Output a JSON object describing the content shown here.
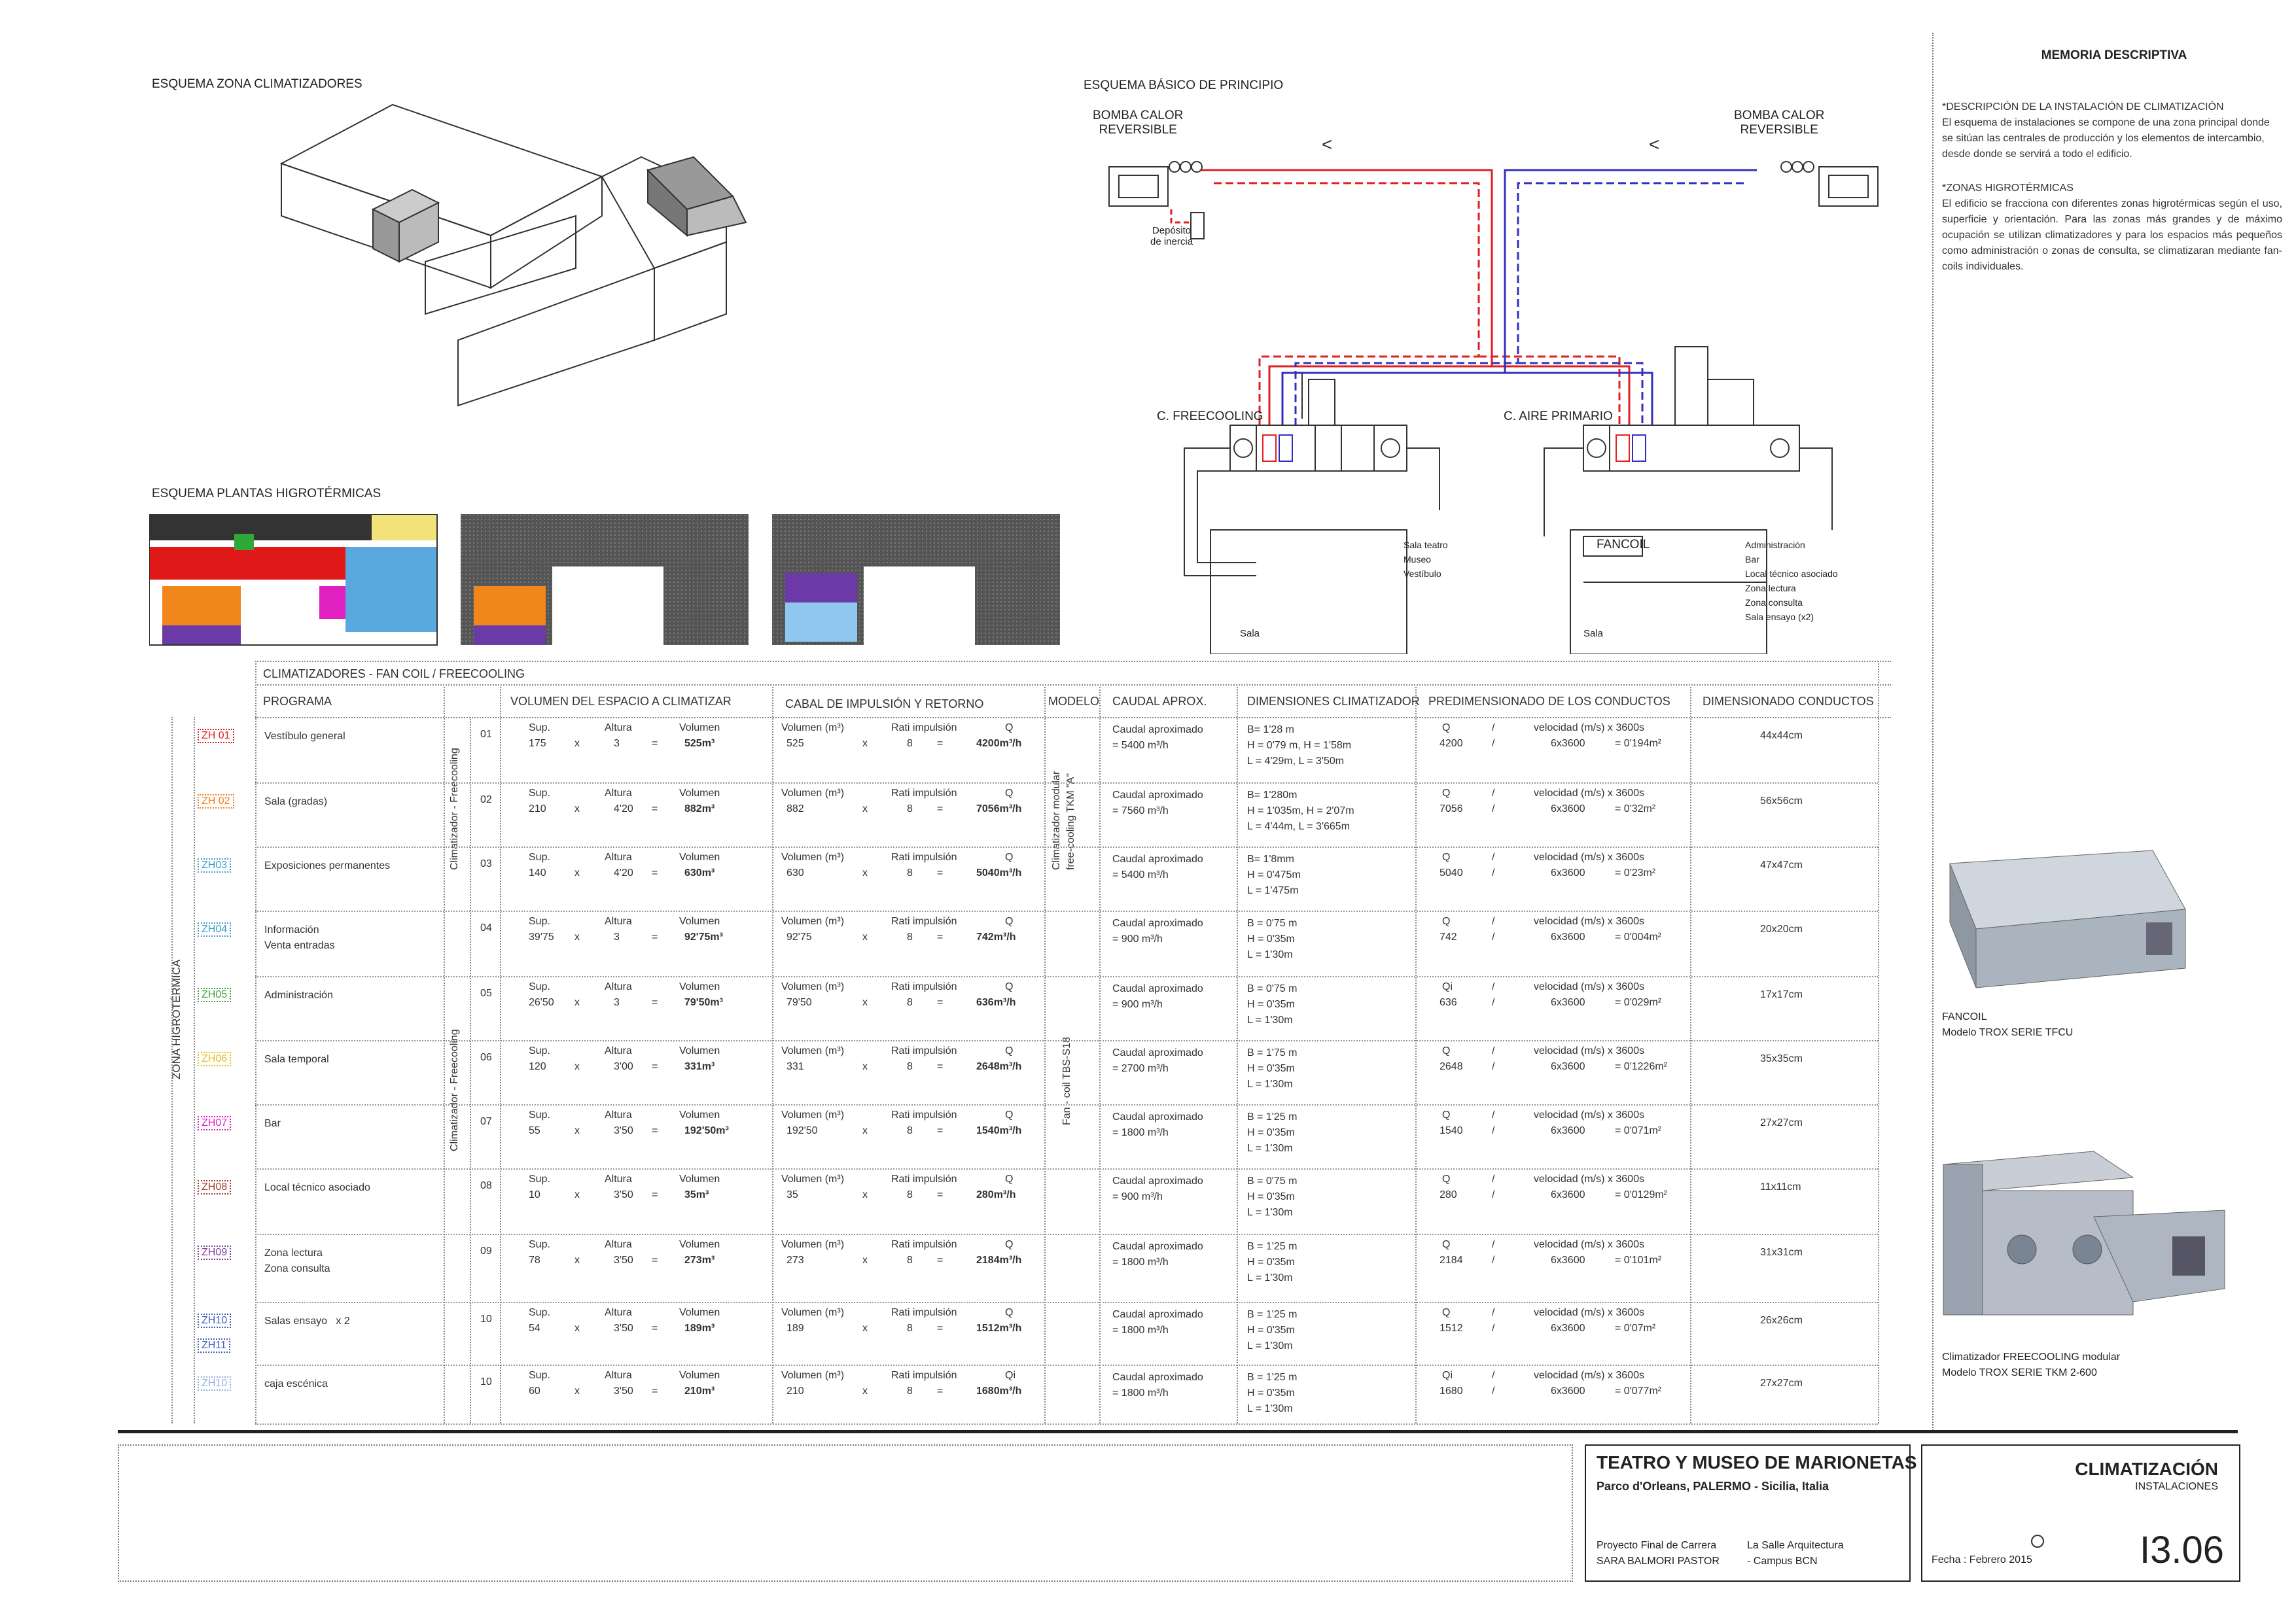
{
  "labels": {
    "esq_zona": "ESQUEMA ZONA CLIMATIZADORES",
    "esq_basico": "ESQUEMA BÁSICO DE PRINCIPIO",
    "esq_plantas": "ESQUEMA PLANTAS HIGROTÉRMICAS",
    "bomba1": "BOMBA CALOR\nREVERSIBLE",
    "bomba2": "BOMBA CALOR\nREVERSIBLE",
    "deposito": "Depósito\nde inercia",
    "freecooling": "C. FREECOOLING",
    "aire_primario": "C. AIRE PRIMARIO",
    "fancoil": "FANCOIL",
    "sala1": "Sala",
    "sala2": "Sala",
    "sala_teatro": "Sala teatro\nMuseo\nVestíbulo",
    "admin_list": "Administración\nBar\nLocal técnico asociado\nZona lectura\nZona consulta\nSala ensayo (x2)"
  },
  "memoria": {
    "title": "MEMORIA DESCRIPTIVA",
    "h1": "*DESCRIPCIÓN DE LA INSTALACIÓN DE CLIMATIZACIÓN",
    "p1": "El esquema de instalaciones se compone de una zona principal donde se sitúan las centrales de producción y los elementos de intercambio, desde donde se servirá a todo el edificio.",
    "h2": "*ZONAS HIGROTÉRMICAS",
    "p2": "El edificio se fracciona con diferentes zonas higrotérmicas según el uso, superficie y orientación. Para las zonas más grandes y de máximo ocupación se utilizan climatizadores y para los espacios más pequeños como administración o zonas de consulta, se climatizaran mediante fan-coils individuales.",
    "fancoil_cap1": "FANCOIL",
    "fancoil_cap2": "Modelo TROX SERIE TFCU",
    "clim_cap1": "Climatizador FREECOOLING modular",
    "clim_cap2": "Modelo TROX SERIE TKM 2-600"
  },
  "table": {
    "title": "CLIMATIZADORES - FAN COIL / FREECOOLING",
    "headers": [
      "PROGRAMA",
      "VOLUMEN DEL ESPACIO A CLIMATIZAR",
      "CABAL DE IMPULSIÓN Y RETORNO",
      "MODELO",
      "CAUDAL APROX.",
      "DIMENSIONES CLIMATIZADOR",
      "PREDIMENSIONADO DE LOS CONDUCTOS",
      "DIMENSIONADO CONDUCTOS"
    ],
    "zona_label": "ZONA HIGROTÉRMICA",
    "group1": "Climatizador - Freecooling",
    "group2": "Climatizador - Freecooling",
    "model1": "Climatizador modular\nfree-cooling TKM \"A\"",
    "model2": "Fan - coil TBS-S18",
    "rows": [
      {
        "zh": "ZH 01",
        "color": "#e02020",
        "prog": "Vestíbulo general",
        "n": "01",
        "sup": "175",
        "alt": "3",
        "vol": "525m³",
        "cv": "525",
        "rat": "8",
        "q": "4200m³/h",
        "caudal": "Caudal aproximado\n= 5400 m³/h",
        "dims": "B= 1'28 m\nH = 0'79 m, H = 1'58m\nL = 4'29m, L = 3'50m",
        "qi": "4200",
        "den": "6x3600",
        "res": "= 0'194m²",
        "dim": "44x44cm"
      },
      {
        "zh": "ZH 02",
        "color": "#f08020",
        "prog": "Sala (gradas)",
        "n": "02",
        "sup": "210",
        "alt": "4'20",
        "vol": "882m³",
        "cv": "882",
        "rat": "8",
        "q": "7056m³/h",
        "caudal": "Caudal aproximado\n= 7560 m³/h",
        "dims": "B= 1'280m\nH = 1'035m, H = 2'07m\nL = 4'44m, L = 3'665m",
        "qi": "7056",
        "den": "6x3600",
        "res": "= 0'32m²",
        "dim": "56x56cm"
      },
      {
        "zh": "ZH03",
        "color": "#3aa0d0",
        "prog": "Exposiciones permanentes",
        "n": "03",
        "sup": "140",
        "alt": "4'20",
        "vol": "630m³",
        "cv": "630",
        "rat": "8",
        "q": "5040m³/h",
        "caudal": "Caudal aproximado\n= 5400 m³/h",
        "dims": "B= 1'8mm\nH = 0'475m\nL = 1'475m",
        "qi": "5040",
        "den": "6x3600",
        "res": "= 0'23m²",
        "dim": "47x47cm"
      },
      {
        "zh": "ZH04",
        "color": "#3aa0d0",
        "prog": "Información\nVenta entradas",
        "n": "04",
        "sup": "39'75",
        "alt": "3",
        "vol": "92'75m³",
        "cv": "92'75",
        "rat": "8",
        "q": "742m³/h",
        "caudal": "Caudal aproximado\n= 900 m³/h",
        "dims": "B = 0'75 m\nH = 0'35m\nL = 1'30m",
        "qi": "742",
        "den": "6x3600",
        "res": "= 0'004m²",
        "dim": "20x20cm"
      },
      {
        "zh": "ZH05",
        "color": "#40a040",
        "prog": "Administración",
        "n": "05",
        "sup": "26'50",
        "alt": "3",
        "vol": "79'50m³",
        "cv": "79'50",
        "rat": "8",
        "q": "636m³/h",
        "caudal": "Caudal aproximado\n= 900 m³/h",
        "dims": "B = 0'75 m\nH = 0'35m\nL = 1'30m",
        "qi": "636",
        "den": "6x3600",
        "res": "= 0'029m²",
        "dim": "17x17cm"
      },
      {
        "zh": "ZH06",
        "color": "#e0c020",
        "prog": "Sala temporal",
        "n": "06",
        "sup": "120",
        "alt": "3'00",
        "vol": "331m³",
        "cv": "331",
        "rat": "8",
        "q": "2648m³/h",
        "caudal": "Caudal aproximado\n= 2700 m³/h",
        "dims": "B = 1'75 m\nH = 0'35m\nL = 1'30m",
        "qi": "2648",
        "den": "6x3600",
        "res": "= 0'1226m²",
        "dim": "35x35cm"
      },
      {
        "zh": "ZH07",
        "color": "#e020c0",
        "prog": "Bar",
        "n": "07",
        "sup": "55",
        "alt": "3'50",
        "vol": "192'50m³",
        "cv": "192'50",
        "rat": "8",
        "q": "1540m³/h",
        "caudal": "Caudal aproximado\n= 1800 m³/h",
        "dims": "B = 1'25 m\nH = 0'35m\nL = 1'30m",
        "qi": "1540",
        "den": "6x3600",
        "res": "= 0'071m²",
        "dim": "27x27cm"
      },
      {
        "zh": "ZH08",
        "color": "#a04030",
        "prog": "Local técnico asociado",
        "n": "08",
        "sup": "10",
        "alt": "3'50",
        "vol": "35m³",
        "cv": "35",
        "rat": "8",
        "q": "280m³/h",
        "caudal": "Caudal aproximado\n= 900 m³/h",
        "dims": "B = 0'75 m\nH = 0'35m\nL = 1'30m",
        "qi": "280",
        "den": "6x3600",
        "res": "= 0'0129m²",
        "dim": "11x11cm"
      },
      {
        "zh": "ZH09",
        "color": "#8040a0",
        "prog": "Zona lectura\nZona consulta",
        "n": "09",
        "sup": "78",
        "alt": "3'50",
        "vol": "273m³",
        "cv": "273",
        "rat": "8",
        "q": "2184m³/h",
        "caudal": "Caudal aproximado\n= 1800 m³/h",
        "dims": "B = 1'25 m\nH = 0'35m\nL = 1'30m",
        "qi": "2184",
        "den": "6x3600",
        "res": "= 0'101m²",
        "dim": "31x31cm"
      },
      {
        "zh": "ZH10",
        "color": "#4060c0",
        "prog": "Salas ensayo   x 2",
        "n": "10",
        "sup": "54",
        "alt": "3'50",
        "vol": "189m³",
        "cv": "189",
        "rat": "8",
        "q": "1512m³/h",
        "caudal": "Caudal aproximado\n= 1800 m³/h",
        "dims": "B = 1'25 m\nH = 0'35m\nL = 1'30m",
        "qi": "1512",
        "den": "6x3600",
        "res": "= 0'07m²",
        "dim": "26x26cm"
      },
      {
        "zh": "ZH10",
        "color": "#90b0e0",
        "prog": "caja escénica",
        "n": "10",
        "sup": "60",
        "alt": "3'50",
        "vol": "210m³",
        "cv": "210",
        "rat": "8",
        "q": "1680m³/h",
        "caudal": "Caudal aproximado\n= 1800 m³/h",
        "dims": "B = 1'25 m\nH = 0'35m\nL = 1'30m",
        "qi": "1680",
        "den": "6x3600",
        "res": "= 0'077m²",
        "dim": "27x27cm"
      }
    ],
    "zh11": "ZH11",
    "cap_sup": "Sup.",
    "cap_alt": "Altura",
    "cap_vol": "Volumen",
    "cap_volm": "Volumen (m³)",
    "cap_rat": "Rati impulsión",
    "cap_q": "Q",
    "cap_qi": "Qi",
    "cap_vel": "velocidad (m/s) x 3600s"
  },
  "footer": {
    "title": "TEATRO Y MUSEO DE MARIONETAS",
    "subtitle": "Parco d'Orleans, PALERMO - Sicilia, Italia",
    "proyecto": "Proyecto Final de Carrera",
    "autor": "SARA BALMORI PASTOR",
    "escuela": "La Salle Arquitectura",
    "campus": "- Campus BCN",
    "section": "CLIMATIZACIÓN",
    "sub": "INSTALACIONES",
    "fecha": "Fecha : Febrero 2015",
    "sheet": "I3.06"
  }
}
